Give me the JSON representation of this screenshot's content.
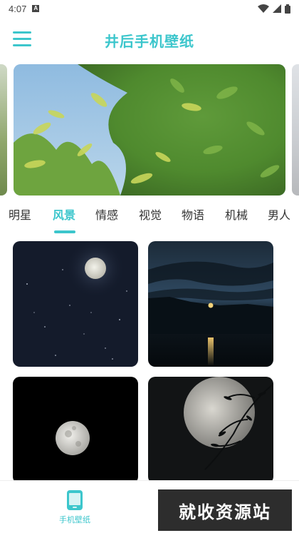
{
  "status_bar": {
    "time": "4:07",
    "notification_icon": "A"
  },
  "header": {
    "title": "井后手机壁纸"
  },
  "tabs": [
    "明星",
    "风景",
    "情感",
    "视觉",
    "物语",
    "机械",
    "男人"
  ],
  "active_tab": "风景",
  "bottom_nav": {
    "label": "手机壁纸"
  },
  "watermark": "就收资源站",
  "colors": {
    "accent": "#3cc6cc",
    "text": "#333333"
  },
  "icons": {
    "menu": "hamburger-icon",
    "phone": "phone-icon",
    "wifi": "wifi-icon",
    "signal": "signal-icon",
    "battery": "battery-icon"
  }
}
